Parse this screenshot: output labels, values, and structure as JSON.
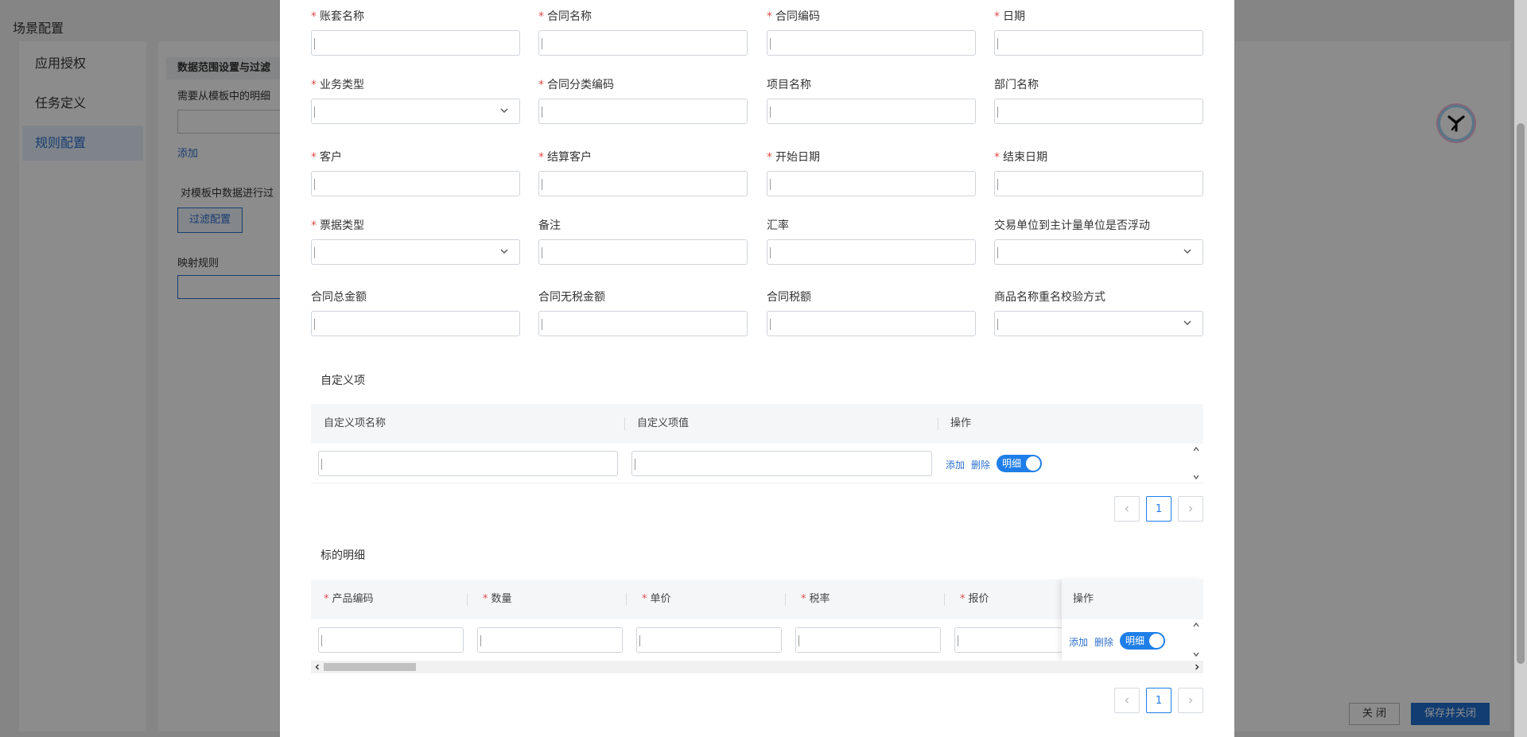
{
  "background": {
    "page_title": "场景配置",
    "sidebar": [
      {
        "label": "应用授权",
        "active": false
      },
      {
        "label": "任务定义",
        "active": false
      },
      {
        "label": "规则配置",
        "active": true
      }
    ],
    "section_header": "数据范围设置与过滤",
    "detail_prompt": "需要从模板中的明细",
    "add_link": "添加",
    "filter_prompt": "对模板中数据进行过",
    "filter_button": "过滤配置",
    "mapping_label": "映射规则",
    "close_button": "关 闭",
    "save_close_button": "保存并关闭"
  },
  "modal": {
    "fields": [
      {
        "label": "账套名称",
        "required": true,
        "type": "text"
      },
      {
        "label": "合同名称",
        "required": true,
        "type": "text"
      },
      {
        "label": "合同编码",
        "required": true,
        "type": "text"
      },
      {
        "label": "日期",
        "required": true,
        "type": "text"
      },
      {
        "label": "业务类型",
        "required": true,
        "type": "select"
      },
      {
        "label": "合同分类编码",
        "required": true,
        "type": "text"
      },
      {
        "label": "项目名称",
        "required": false,
        "type": "text"
      },
      {
        "label": "部门名称",
        "required": false,
        "type": "text"
      },
      {
        "label": "客户",
        "required": true,
        "type": "text"
      },
      {
        "label": "结算客户",
        "required": true,
        "type": "text"
      },
      {
        "label": "开始日期",
        "required": true,
        "type": "text"
      },
      {
        "label": "结束日期",
        "required": true,
        "type": "text"
      },
      {
        "label": "票据类型",
        "required": true,
        "type": "select"
      },
      {
        "label": "备注",
        "required": false,
        "type": "text"
      },
      {
        "label": "汇率",
        "required": false,
        "type": "text"
      },
      {
        "label": "交易单位到主计量单位是否浮动",
        "required": false,
        "type": "select"
      },
      {
        "label": "合同总金额",
        "required": false,
        "type": "text"
      },
      {
        "label": "合同无税金额",
        "required": false,
        "type": "text"
      },
      {
        "label": "合同税额",
        "required": false,
        "type": "text"
      },
      {
        "label": "商品名称重名校验方式",
        "required": false,
        "type": "select"
      }
    ],
    "custom_section": {
      "title": "自定义项",
      "columns": [
        "自定义项名称",
        "自定义项值",
        "操作"
      ],
      "add": "添加",
      "delete": "删除",
      "toggle_label": "明细",
      "page": "1"
    },
    "detail_section": {
      "title": "标的明细",
      "columns": [
        {
          "label": "产品编码",
          "required": true
        },
        {
          "label": "数量",
          "required": true
        },
        {
          "label": "单价",
          "required": true
        },
        {
          "label": "税率",
          "required": true
        },
        {
          "label": "报价",
          "required": true
        }
      ],
      "op_column": "操作",
      "add": "添加",
      "delete": "删除",
      "toggle_label": "明细",
      "page": "1"
    }
  },
  "colors": {
    "primary": "#1f7ee8",
    "required": "#e34c4c",
    "link": "#2f6fce"
  }
}
